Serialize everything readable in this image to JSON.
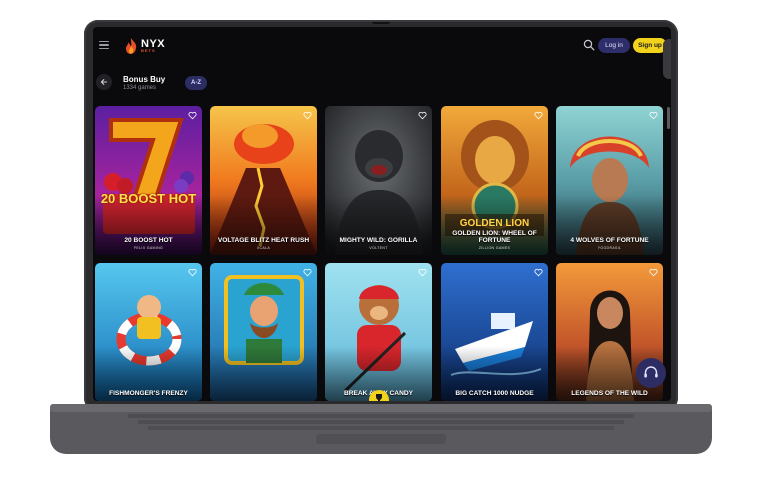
{
  "header": {
    "logo_text": "NYX",
    "logo_sub": "BETS",
    "login_label": "Log in",
    "signup_label": "Sign up"
  },
  "section": {
    "title": "Bonus Buy",
    "count": "1334 games",
    "sort_label": "A-Z"
  },
  "games": [
    {
      "name": "20 BOOST HOT",
      "provider": "FELIX GAMING"
    },
    {
      "name": "VOLTAGE BLITZ HEAT RUSH",
      "provider": "XCALA"
    },
    {
      "name": "MIGHTY WILD: GORILLA",
      "provider": "VOLTENT"
    },
    {
      "name": "GOLDEN LION: WHEEL OF FORTUNE",
      "provider": "ZILLION GAMES"
    },
    {
      "name": "4 WOLVES OF FORTUNE",
      "provider": "YGGDRASIL"
    },
    {
      "name": "FISHMONGER'S FRENZY",
      "provider": ""
    },
    {
      "name": "",
      "provider": ""
    },
    {
      "name": "BREAK AWAY CANDY",
      "provider": ""
    },
    {
      "name": "BIG CATCH 1000 NUDGE",
      "provider": ""
    },
    {
      "name": "LEGENDS OF THE WILD",
      "provider": ""
    }
  ],
  "tile_art": {
    "boost": "20 BOOST HOT",
    "golden": "GOLDEN LION"
  },
  "colors": {
    "background": "#0a0a0c",
    "accent_yellow": "#f2d21a",
    "accent_navy": "#2d2d63"
  }
}
